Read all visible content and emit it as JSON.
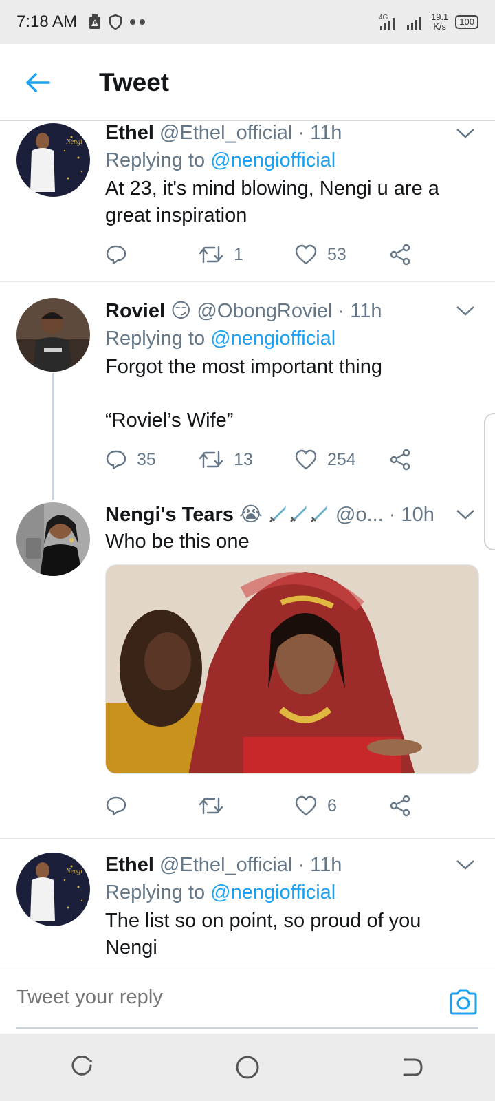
{
  "status_bar": {
    "time": "7:18 AM",
    "network": "4G",
    "speed_value": "19.1",
    "speed_unit": "K/s",
    "battery": "100"
  },
  "app_bar": {
    "title": "Tweet"
  },
  "tweets": [
    {
      "name": "Ethel",
      "handle": "@Ethel_official",
      "time": "· 11h",
      "replying_prefix": "Replying to",
      "replying_to": "@nengiofficial",
      "text": "At 23, it's mind blowing, Nengi u are a great inspiration",
      "replies": "",
      "retweets": "1",
      "likes": "53"
    },
    {
      "name": "Roviel",
      "emoji": "😏",
      "handle": "@ObongRoviel",
      "time": "· 11h",
      "replying_prefix": "Replying to",
      "replying_to": "@nengiofficial",
      "text": "Forgot the most important thing\n\n“Roviel’s Wife”",
      "replies": "35",
      "retweets": "13",
      "likes": "254"
    },
    {
      "name": "Nengi's Tears",
      "emoji": "😭",
      "handle": "@o...",
      "time": "· 10h",
      "text": "Who be this one",
      "replies": "",
      "retweets": "",
      "likes": "6"
    },
    {
      "name": "Ethel",
      "handle": "@Ethel_official",
      "time": "· 11h",
      "replying_prefix": "Replying to",
      "replying_to": "@nengiofficial",
      "text": "The list so on point, so proud of you Nengi"
    }
  ],
  "reply_bar": {
    "placeholder": "Tweet your reply"
  },
  "colors": {
    "accent": "#1da1f2",
    "secondary_text": "#657786",
    "primary_text": "#14171a",
    "divider": "#e1e8ed"
  },
  "icons": [
    "back-arrow-icon",
    "chevron-down-icon",
    "reply-icon",
    "retweet-icon",
    "like-icon",
    "share-icon",
    "camera-icon",
    "recent-apps-icon",
    "home-icon",
    "back-icon"
  ]
}
